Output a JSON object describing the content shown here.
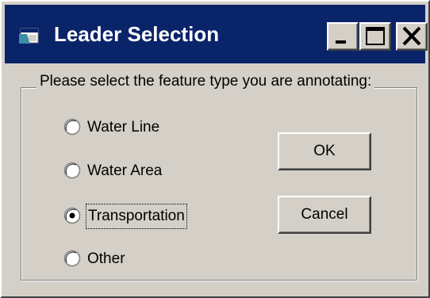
{
  "window": {
    "title": "Leader Selection",
    "icon": "app-window-icon",
    "controls": {
      "minimize": "minimize-icon",
      "maximize": "maximize-icon",
      "close": "close-icon"
    }
  },
  "group": {
    "label": "Please select the feature type you are annotating:"
  },
  "options": [
    {
      "label": "Water Line",
      "selected": false
    },
    {
      "label": "Water Area",
      "selected": false
    },
    {
      "label": "Transportation",
      "selected": true,
      "focused": true
    },
    {
      "label": "Other",
      "selected": false
    }
  ],
  "buttons": {
    "ok": "OK",
    "cancel": "Cancel"
  },
  "colors": {
    "titlebar": "#0a246a",
    "face": "#d4d0c8",
    "title_text": "#ffffff"
  }
}
